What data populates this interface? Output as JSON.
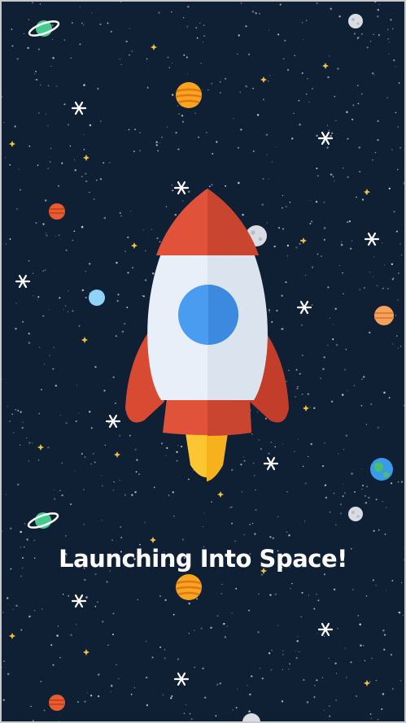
{
  "screen": {
    "caption": "Launching Into Space!",
    "background_color": "#102034"
  },
  "rocket": {
    "icon": "rocket-icon",
    "body_color": "#e9eff8",
    "nose_color": "#e0533a",
    "window_color": "#4a9cf0",
    "flame_color": "#fbc632"
  },
  "decorations": {
    "planets": [
      "ringed-planet-icon",
      "banded-planet-icon",
      "moon-icon",
      "earth-icon"
    ],
    "stars": [
      "sparkle-star-icon",
      "small-star-icon"
    ]
  }
}
